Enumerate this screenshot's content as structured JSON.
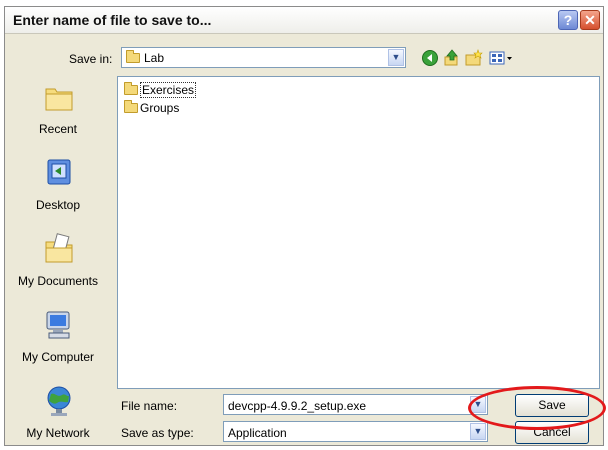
{
  "dialog": {
    "title": "Enter name of file to save to...",
    "help_glyph": "?",
    "close_glyph": "✕"
  },
  "save_in": {
    "label": "Save in:",
    "value": "Lab"
  },
  "places": [
    {
      "label": "Recent",
      "icon": "recent-folder-icon"
    },
    {
      "label": "Desktop",
      "icon": "desktop-icon"
    },
    {
      "label": "My Documents",
      "icon": "my-documents-icon"
    },
    {
      "label": "My Computer",
      "icon": "my-computer-icon"
    },
    {
      "label": "My Network",
      "icon": "my-network-icon"
    }
  ],
  "files": [
    {
      "name": "Exercises"
    },
    {
      "name": "Groups"
    }
  ],
  "file_name": {
    "label": "File name:",
    "value": "devcpp-4.9.9.2_setup.exe"
  },
  "save_as_type": {
    "label": "Save as type:",
    "value": "Application"
  },
  "buttons": {
    "save": "Save",
    "cancel": "Cancel"
  },
  "colors": {
    "dialog_bg": "#ece9d8",
    "highlight": "#e3191b"
  }
}
